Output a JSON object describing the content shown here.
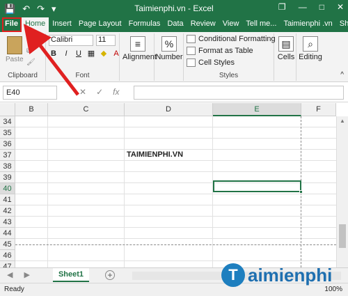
{
  "titlebar": {
    "title": "Taimienphi.vn - Excel",
    "qat_save": "💾",
    "qat_undo": "↶",
    "qat_redo": "↷",
    "qat_more": "▾",
    "restore_icon": "❐",
    "min_icon": "—",
    "max_icon": "□",
    "close_icon": "✕"
  },
  "tabs": {
    "file": "File",
    "home": "Home",
    "insert": "Insert",
    "page_layout": "Page Layout",
    "formulas": "Formulas",
    "data": "Data",
    "review": "Review",
    "view": "View",
    "tell_me": "Tell me...",
    "account": "Taimienphi .vn",
    "share": "Share"
  },
  "ribbon": {
    "paste_label": "Paste",
    "clipboard_label": "Clipboard",
    "font_name": "Calibri",
    "font_size": "11",
    "bold": "B",
    "italic": "I",
    "underline": "U",
    "font_label": "Font",
    "alignment_label": "Alignment",
    "number_label": "Number",
    "number_icon": "%",
    "conditional_formatting": "Conditional Formatting",
    "format_as_table": "Format as Table",
    "cell_styles": "Cell Styles",
    "styles_label": "Styles",
    "cells_label": "Cells",
    "editing_label": "Editing"
  },
  "formula_bar": {
    "name_box": "E40",
    "cancel": "✕",
    "enter": "✓",
    "fx": "fx",
    "formula": ""
  },
  "grid": {
    "columns": [
      "B",
      "C",
      "D",
      "E",
      "F"
    ],
    "rows": [
      "34",
      "35",
      "36",
      "37",
      "38",
      "39",
      "40",
      "41",
      "42",
      "43",
      "44",
      "45",
      "46",
      "47"
    ],
    "cell_d37": "TAIMIENPHI.VN"
  },
  "sheets": {
    "active": "Sheet1",
    "add": "+"
  },
  "status": {
    "ready": "Ready",
    "zoom": "100%"
  },
  "watermark": {
    "logo_letter": "T",
    "text": "aimienphi"
  },
  "colors": {
    "accent": "#217346",
    "annotation": "#e02020"
  }
}
